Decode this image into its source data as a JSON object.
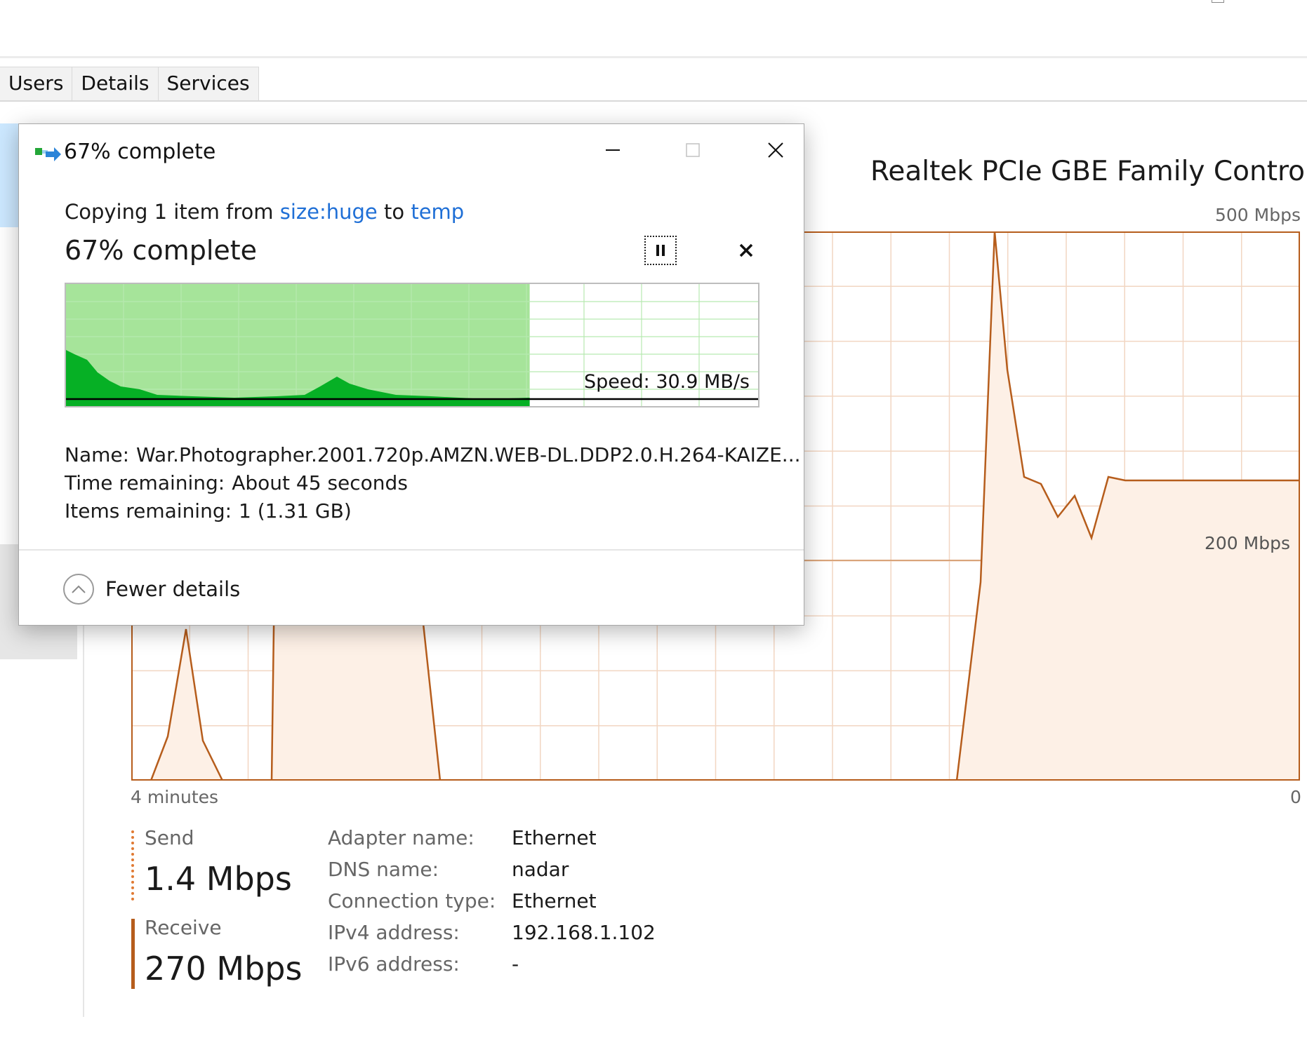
{
  "task_manager": {
    "tabs": [
      {
        "label": "Users"
      },
      {
        "label": "Details"
      },
      {
        "label": "Services"
      }
    ],
    "adapter_title": "Realtek PCIe GBE Family Controller",
    "graph": {
      "y_max_label": "500 Mbps",
      "y_mid_label": "200 Mbps",
      "x_left_label": "4 minutes",
      "x_right_label": "0",
      "line_color": "#b65d1c",
      "fill_color": "#fdf0e6",
      "grid_color": "#f2d6c2"
    },
    "send": {
      "label": "Send",
      "value": "1.4 Mbps",
      "color": "#e07a33"
    },
    "receive": {
      "label": "Receive",
      "value": "270 Mbps",
      "color": "#b65d1c"
    },
    "properties": [
      {
        "key": "Adapter name:",
        "value": "Ethernet"
      },
      {
        "key": "DNS name:",
        "value": "nadar"
      },
      {
        "key": "Connection type:",
        "value": "Ethernet"
      },
      {
        "key": "IPv4 address:",
        "value": "192.168.1.102"
      },
      {
        "key": "IPv6 address:",
        "value": "-"
      }
    ]
  },
  "copy_dialog": {
    "title": "67% complete",
    "copy_prefix": "Copying 1 item from",
    "source": "size:huge",
    "to_word": "to",
    "destination": "temp",
    "heading": "67% complete",
    "progress": 0.67,
    "speed_label": "Speed: 30.9 MB/s",
    "name_key": "Name:",
    "name_value": "War.Photographer.2001.720p.AMZN.WEB-DL.DDP2.0.H.264-KAIZE...",
    "time_key": "Time remaining:",
    "time_value": "About 45 seconds",
    "items_key": "Items remaining:",
    "items_value": "1 (1.31 GB)",
    "fewer_details": "Fewer details",
    "colors": {
      "progress_fill": "#a6e49a",
      "speed_fill": "#06b025",
      "grid": "#b7e9b0"
    }
  }
}
